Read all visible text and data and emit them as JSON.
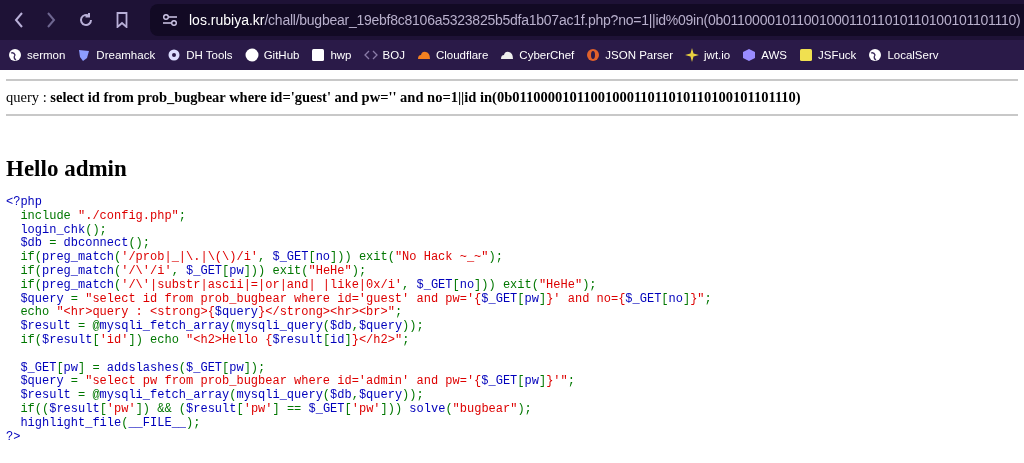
{
  "browser": {
    "url_host": "los.rubiya.kr",
    "url_path": "/chall/bugbear_19ebf8c8106a5323825b5dfa1b07ac1f.php?no=1||id%09in(0b0110000101100100011011010110100101101110)",
    "bookmarks": [
      {
        "label": "sermon"
      },
      {
        "label": "Dreamhack"
      },
      {
        "label": "DH Tools"
      },
      {
        "label": "GitHub"
      },
      {
        "label": "hwp"
      },
      {
        "label": "BOJ"
      },
      {
        "label": "Cloudflare"
      },
      {
        "label": "CyberChef"
      },
      {
        "label": "JSON Parser"
      },
      {
        "label": "jwt.io"
      },
      {
        "label": "AWS"
      },
      {
        "label": "JSFuck"
      },
      {
        "label": "LocalServ"
      }
    ]
  },
  "page": {
    "query": "query : **select id from prob_bugbear where id='guest' and pw='' and no=1||id in(0b0110000101100100011011010110100101101110)**",
    "heading": "Hello admin",
    "code": [
      {
        "kind": "code",
        "indented": false,
        "tokens": [
          {
            "kind": "default",
            "text": "<?php"
          }
        ]
      },
      {
        "kind": "code",
        "indented": true,
        "tokens": [
          {
            "kind": "keyword",
            "text": "include "
          },
          {
            "kind": "string",
            "text": "\"./config.php\""
          },
          {
            "kind": "keyword",
            "text": ";"
          }
        ]
      },
      {
        "kind": "code",
        "indented": true,
        "tokens": [
          {
            "kind": "default",
            "text": "login_chk"
          },
          {
            "kind": "keyword",
            "text": "();"
          }
        ]
      },
      {
        "kind": "code",
        "indented": true,
        "tokens": [
          {
            "kind": "default",
            "text": "$db "
          },
          {
            "kind": "keyword",
            "text": "= "
          },
          {
            "kind": "default",
            "text": "dbconnect"
          },
          {
            "kind": "keyword",
            "text": "();"
          }
        ]
      },
      {
        "kind": "code",
        "indented": true,
        "tokens": [
          {
            "kind": "keyword",
            "text": "if("
          },
          {
            "kind": "default",
            "text": "preg_match"
          },
          {
            "kind": "keyword",
            "text": "("
          },
          {
            "kind": "string",
            "text": "'/prob|_|\\.|\\(\\)/i'"
          },
          {
            "kind": "keyword",
            "text": ", "
          },
          {
            "kind": "default",
            "text": "$_GET"
          },
          {
            "kind": "keyword",
            "text": "["
          },
          {
            "kind": "default",
            "text": "no"
          },
          {
            "kind": "keyword",
            "text": "])) exit("
          },
          {
            "kind": "string",
            "text": "\"No Hack ~_~\""
          },
          {
            "kind": "keyword",
            "text": ");"
          }
        ]
      },
      {
        "kind": "code",
        "indented": true,
        "tokens": [
          {
            "kind": "keyword",
            "text": "if("
          },
          {
            "kind": "default",
            "text": "preg_match"
          },
          {
            "kind": "keyword",
            "text": "("
          },
          {
            "kind": "string",
            "text": "'/\\'/i'"
          },
          {
            "kind": "keyword",
            "text": ", "
          },
          {
            "kind": "default",
            "text": "$_GET"
          },
          {
            "kind": "keyword",
            "text": "["
          },
          {
            "kind": "default",
            "text": "pw"
          },
          {
            "kind": "keyword",
            "text": "])) exit("
          },
          {
            "kind": "string",
            "text": "\"HeHe\""
          },
          {
            "kind": "keyword",
            "text": ");"
          }
        ]
      },
      {
        "kind": "code",
        "indented": true,
        "tokens": [
          {
            "kind": "keyword",
            "text": "if("
          },
          {
            "kind": "default",
            "text": "preg_match"
          },
          {
            "kind": "keyword",
            "text": "("
          },
          {
            "kind": "string",
            "text": "'/\\'|substr|ascii|=|or|and| |like|0x/i'"
          },
          {
            "kind": "keyword",
            "text": ", "
          },
          {
            "kind": "default",
            "text": "$_GET"
          },
          {
            "kind": "keyword",
            "text": "["
          },
          {
            "kind": "default",
            "text": "no"
          },
          {
            "kind": "keyword",
            "text": "])) exit("
          },
          {
            "kind": "string",
            "text": "\"HeHe\""
          },
          {
            "kind": "keyword",
            "text": ");"
          }
        ]
      },
      {
        "kind": "code",
        "indented": true,
        "tokens": [
          {
            "kind": "default",
            "text": "$query "
          },
          {
            "kind": "keyword",
            "text": "= "
          },
          {
            "kind": "string",
            "text": "\"select id from prob_bugbear where id='guest' and pw='{"
          },
          {
            "kind": "default",
            "text": "$_GET"
          },
          {
            "kind": "keyword",
            "text": "["
          },
          {
            "kind": "default",
            "text": "pw"
          },
          {
            "kind": "keyword",
            "text": "]"
          },
          {
            "kind": "string",
            "text": "}' and no={"
          },
          {
            "kind": "default",
            "text": "$_GET"
          },
          {
            "kind": "keyword",
            "text": "["
          },
          {
            "kind": "default",
            "text": "no"
          },
          {
            "kind": "keyword",
            "text": "]"
          },
          {
            "kind": "string",
            "text": "}\""
          },
          {
            "kind": "keyword",
            "text": ";"
          }
        ]
      },
      {
        "kind": "code",
        "indented": true,
        "tokens": [
          {
            "kind": "keyword",
            "text": "echo "
          },
          {
            "kind": "string",
            "text": "\"<hr>query : <strong>{"
          },
          {
            "kind": "default",
            "text": "$query"
          },
          {
            "kind": "string",
            "text": "}</strong><hr><br>\""
          },
          {
            "kind": "keyword",
            "text": ";"
          }
        ]
      },
      {
        "kind": "code",
        "indented": true,
        "tokens": [
          {
            "kind": "default",
            "text": "$result "
          },
          {
            "kind": "keyword",
            "text": "= @"
          },
          {
            "kind": "default",
            "text": "mysqli_fetch_array"
          },
          {
            "kind": "keyword",
            "text": "("
          },
          {
            "kind": "default",
            "text": "mysqli_query"
          },
          {
            "kind": "keyword",
            "text": "("
          },
          {
            "kind": "default",
            "text": "$db"
          },
          {
            "kind": "keyword",
            "text": ","
          },
          {
            "kind": "default",
            "text": "$query"
          },
          {
            "kind": "keyword",
            "text": "));"
          }
        ]
      },
      {
        "kind": "code",
        "indented": true,
        "tokens": [
          {
            "kind": "keyword",
            "text": "if("
          },
          {
            "kind": "default",
            "text": "$result"
          },
          {
            "kind": "keyword",
            "text": "["
          },
          {
            "kind": "string",
            "text": "'id'"
          },
          {
            "kind": "keyword",
            "text": "]) echo "
          },
          {
            "kind": "string",
            "text": "\"<h2>Hello {"
          },
          {
            "kind": "default",
            "text": "$result"
          },
          {
            "kind": "keyword",
            "text": "["
          },
          {
            "kind": "default",
            "text": "id"
          },
          {
            "kind": "keyword",
            "text": "]"
          },
          {
            "kind": "string",
            "text": "}</h2>\""
          },
          {
            "kind": "keyword",
            "text": ";"
          }
        ]
      },
      {
        "kind": "blank"
      },
      {
        "kind": "code",
        "indented": true,
        "tokens": [
          {
            "kind": "default",
            "text": "$_GET"
          },
          {
            "kind": "keyword",
            "text": "["
          },
          {
            "kind": "default",
            "text": "pw"
          },
          {
            "kind": "keyword",
            "text": "] = "
          },
          {
            "kind": "default",
            "text": "addslashes"
          },
          {
            "kind": "keyword",
            "text": "("
          },
          {
            "kind": "default",
            "text": "$_GET"
          },
          {
            "kind": "keyword",
            "text": "["
          },
          {
            "kind": "default",
            "text": "pw"
          },
          {
            "kind": "keyword",
            "text": "]);"
          }
        ]
      },
      {
        "kind": "code",
        "indented": true,
        "tokens": [
          {
            "kind": "default",
            "text": "$query "
          },
          {
            "kind": "keyword",
            "text": "= "
          },
          {
            "kind": "string",
            "text": "\"select pw from prob_bugbear where id='admin' and pw='{"
          },
          {
            "kind": "default",
            "text": "$_GET"
          },
          {
            "kind": "keyword",
            "text": "["
          },
          {
            "kind": "default",
            "text": "pw"
          },
          {
            "kind": "keyword",
            "text": "]"
          },
          {
            "kind": "string",
            "text": "}'\""
          },
          {
            "kind": "keyword",
            "text": ";"
          }
        ]
      },
      {
        "kind": "code",
        "indented": true,
        "tokens": [
          {
            "kind": "default",
            "text": "$result "
          },
          {
            "kind": "keyword",
            "text": "= @"
          },
          {
            "kind": "default",
            "text": "mysqli_fetch_array"
          },
          {
            "kind": "keyword",
            "text": "("
          },
          {
            "kind": "default",
            "text": "mysqli_query"
          },
          {
            "kind": "keyword",
            "text": "("
          },
          {
            "kind": "default",
            "text": "$db"
          },
          {
            "kind": "keyword",
            "text": ","
          },
          {
            "kind": "default",
            "text": "$query"
          },
          {
            "kind": "keyword",
            "text": "));"
          }
        ]
      },
      {
        "kind": "code",
        "indented": true,
        "tokens": [
          {
            "kind": "keyword",
            "text": "if(("
          },
          {
            "kind": "default",
            "text": "$result"
          },
          {
            "kind": "keyword",
            "text": "["
          },
          {
            "kind": "string",
            "text": "'pw'"
          },
          {
            "kind": "keyword",
            "text": "]) && ("
          },
          {
            "kind": "default",
            "text": "$result"
          },
          {
            "kind": "keyword",
            "text": "["
          },
          {
            "kind": "string",
            "text": "'pw'"
          },
          {
            "kind": "keyword",
            "text": "] == "
          },
          {
            "kind": "default",
            "text": "$_GET"
          },
          {
            "kind": "keyword",
            "text": "["
          },
          {
            "kind": "string",
            "text": "'pw'"
          },
          {
            "kind": "keyword",
            "text": "])) "
          },
          {
            "kind": "default",
            "text": "solve"
          },
          {
            "kind": "keyword",
            "text": "("
          },
          {
            "kind": "string",
            "text": "\"bugbear\""
          },
          {
            "kind": "keyword",
            "text": ");"
          }
        ]
      },
      {
        "kind": "code",
        "indented": true,
        "tokens": [
          {
            "kind": "default",
            "text": "highlight_file"
          },
          {
            "kind": "keyword",
            "text": "("
          },
          {
            "kind": "default",
            "text": "__FILE__"
          },
          {
            "kind": "keyword",
            "text": ");"
          }
        ]
      },
      {
        "kind": "code",
        "indented": false,
        "tokens": [
          {
            "kind": "default",
            "text": "?>"
          }
        ]
      }
    ]
  }
}
